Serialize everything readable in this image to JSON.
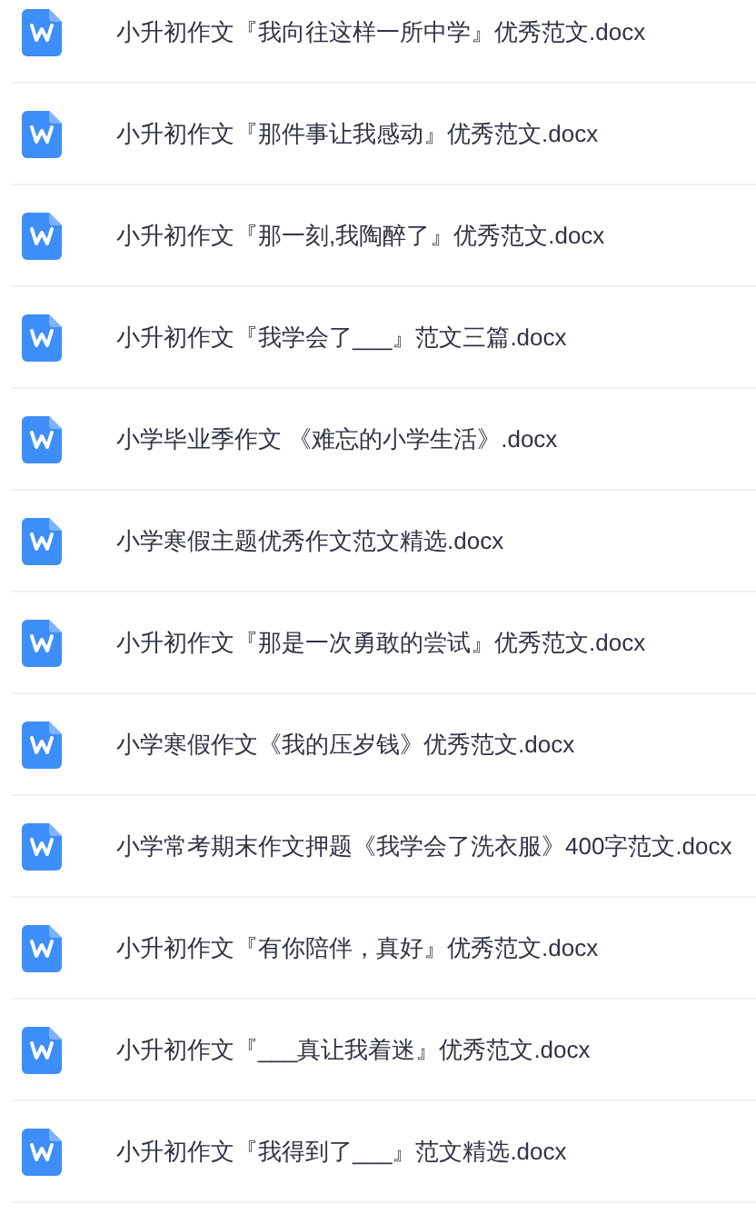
{
  "files": [
    {
      "name": "小升初作文『我向往这样一所中学』优秀范文.docx"
    },
    {
      "name": "小升初作文『那件事让我感动』优秀范文.docx"
    },
    {
      "name": "小升初作文『那一刻,我陶醉了』优秀范文.docx"
    },
    {
      "name": "小升初作文『我学会了___』范文三篇.docx"
    },
    {
      "name": "小学毕业季作文 《难忘的小学生活》.docx"
    },
    {
      "name": "小学寒假主题优秀作文范文精选.docx"
    },
    {
      "name": "小升初作文『那是一次勇敢的尝试』优秀范文.docx"
    },
    {
      "name": "小学寒假作文《我的压岁钱》优秀范文.docx"
    },
    {
      "name": "小学常考期末作文押题《我学会了洗衣服》400字范文.docx"
    },
    {
      "name": "小升初作文『有你陪伴，真好』优秀范文.docx"
    },
    {
      "name": "小升初作文『___真让我着迷』优秀范文.docx"
    },
    {
      "name": "小升初作文『我得到了___』范文精选.docx"
    }
  ]
}
